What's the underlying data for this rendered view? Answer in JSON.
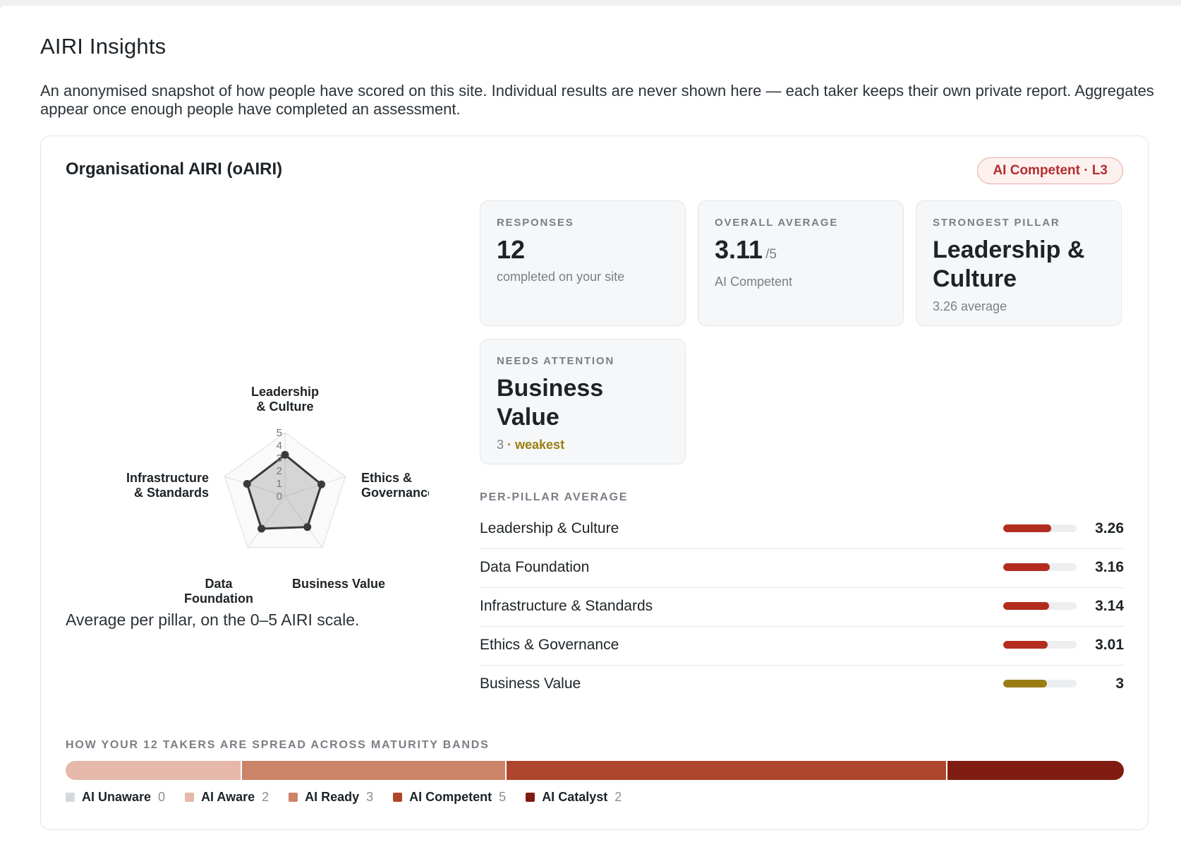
{
  "page": {
    "title": "AIRI Insights",
    "intro": "An anonymised snapshot of how people have scored on this site. Individual results are never shown here — each taker keeps their own private report. Aggregates appear once enough people have completed an assessment."
  },
  "card": {
    "title": "Organisational AIRI (oAIRI)",
    "level_badge": "AI Competent · L3"
  },
  "radar": {
    "scale_max": 5,
    "tick_labels": [
      "0",
      "1",
      "2",
      "3",
      "4",
      "5"
    ],
    "axes": [
      {
        "label_line1": "Leadership",
        "label_line2": "& Culture",
        "value": 3.26
      },
      {
        "label_line1": "Ethics &",
        "label_line2": "Governance",
        "value": 3.01
      },
      {
        "label_line1": "Business Value",
        "label_line2": "",
        "value": 3
      },
      {
        "label_line1": "Data",
        "label_line2": "Foundation",
        "value": 3.16
      },
      {
        "label_line1": "Infrastructure",
        "label_line2": "& Standards",
        "value": 3.14
      }
    ],
    "caption": "Average per pillar, on the 0–5 AIRI scale."
  },
  "stats": {
    "responses": {
      "label": "RESPONSES",
      "value": "12",
      "sub": "completed on your site"
    },
    "overall": {
      "label": "OVERALL AVERAGE",
      "value": "3.11",
      "suffix": "/5",
      "sub": "AI Competent"
    },
    "strongest": {
      "label": "STRONGEST PILLAR",
      "value_line1": "Leadership &",
      "value_line2": "Culture",
      "sub": "3.26 average"
    },
    "attention": {
      "label": "NEEDS ATTENTION",
      "value_line1": "Business",
      "value_line2": "Value",
      "sub_value": "3",
      "sub_sep": " · ",
      "sub_tag": "weakest"
    }
  },
  "per_pillar": {
    "heading": "PER-PILLAR AVERAGE",
    "rows": [
      {
        "name": "Leadership & Culture",
        "value": "3.26",
        "fraction": 0.652,
        "weak": false
      },
      {
        "name": "Data Foundation",
        "value": "3.16",
        "fraction": 0.632,
        "weak": false
      },
      {
        "name": "Infrastructure & Standards",
        "value": "3.14",
        "fraction": 0.628,
        "weak": false
      },
      {
        "name": "Ethics & Governance",
        "value": "3.01",
        "fraction": 0.602,
        "weak": false
      },
      {
        "name": "Business Value",
        "value": "3",
        "fraction": 0.6,
        "weak": true
      }
    ]
  },
  "bands": {
    "heading": "HOW YOUR 12 TAKERS ARE SPREAD ACROSS MATURITY BANDS",
    "items": [
      {
        "name": "AI Unaware",
        "count": "0",
        "color": "#d5d8dc"
      },
      {
        "name": "AI Aware",
        "count": "2",
        "color": "#e6b8a9"
      },
      {
        "name": "AI Ready",
        "count": "3",
        "color": "#cb8468"
      },
      {
        "name": "AI Competent",
        "count": "5",
        "color": "#ae452c"
      },
      {
        "name": "AI Catalyst",
        "count": "2",
        "color": "#801d12"
      }
    ]
  }
}
